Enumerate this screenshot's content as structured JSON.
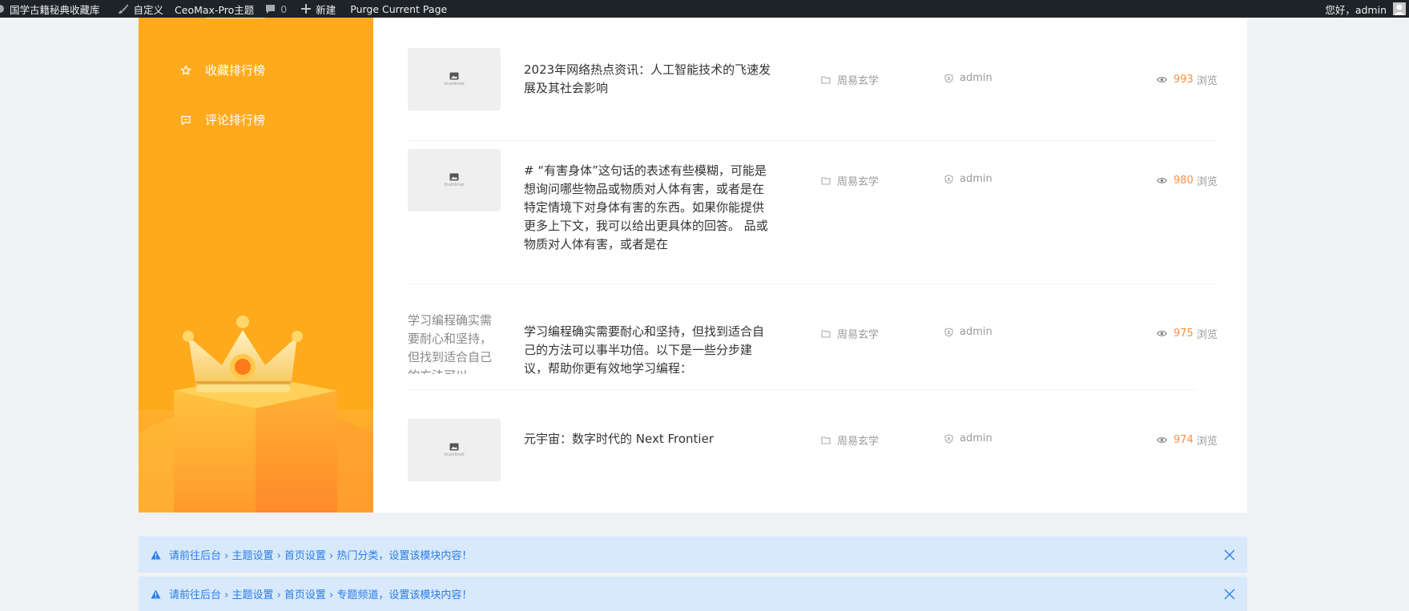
{
  "adminbar": {
    "site_name": "国学古籍秘典收藏库",
    "customize": "自定义",
    "theme": "CeoMax-Pro主题",
    "comments_count": "0",
    "new": "新建",
    "purge": "Purge Current Page",
    "greeting": "您好，admin"
  },
  "sidebar": {
    "items": [
      {
        "label": "收藏排行榜",
        "icon": "star-icon"
      },
      {
        "label": "评论排行榜",
        "icon": "comment-icon"
      }
    ]
  },
  "posts": [
    {
      "thumb_label": "thumbnail",
      "title": "2023年网络热点资讯：人工智能技术的飞速发展及其社会影响",
      "category": "周易玄学",
      "author": "admin",
      "views": "993",
      "views_unit": "浏览"
    },
    {
      "thumb_label": "thumbnail",
      "title": "# “有害身体”这句话的表述有些模糊，可能是想询问哪些物品或物质对人体有害，或者是在特定情境下对身体有害的东西。如果你能提供更多上下文，我可以给出更具体的回答。 品或物质对人体有害，或者是在",
      "category": "周易玄学",
      "author": "admin",
      "views": "980",
      "views_unit": "浏览"
    },
    {
      "thumb_alt": "学习编程确实需要耐心和坚持，但找到适合自己的方法可以",
      "title": "学习编程确实需要耐心和坚持，但找到适合自己的方法可以事半功倍。以下是一些分步建议，帮助你更有效地学习编程：",
      "category": "周易玄学",
      "author": "admin",
      "views": "975",
      "views_unit": "浏览"
    },
    {
      "thumb_label": "thumbnail",
      "title": "元宇宙：数字时代的 Next Frontier",
      "category": "周易玄学",
      "author": "admin",
      "views": "974",
      "views_unit": "浏览"
    }
  ],
  "alerts": [
    "请前往后台 › 主题设置 › 首页设置 › 热门分类，设置该模块内容！",
    "请前往后台 › 主题设置 › 首页设置 › 专题频道，设置该模块内容！"
  ],
  "colors": {
    "sidebar": "#ffaa1c",
    "accent_views": "#ff8e3c",
    "alert_bg": "#d7e9fb",
    "alert_text": "#2b7de9",
    "adminbar_bg": "#1d2327"
  }
}
